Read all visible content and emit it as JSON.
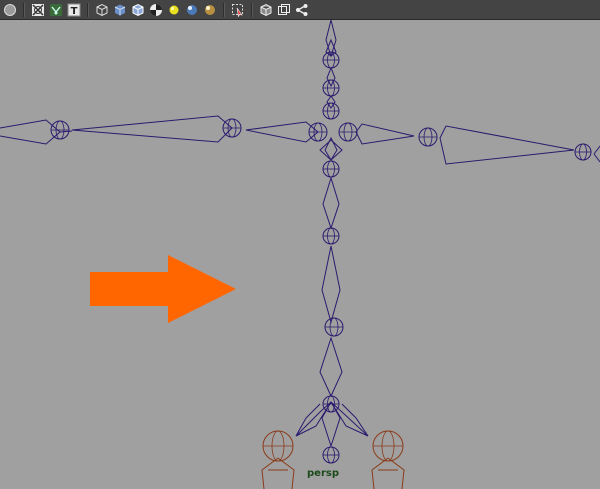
{
  "toolbar": {
    "items": [
      {
        "icon": "smooth-shade-icon"
      },
      {
        "icon": "wireframe-icon"
      },
      {
        "icon": "xray-icon"
      },
      {
        "icon": "texture-icon",
        "glyph": "T"
      },
      {
        "icon": "wire-cube-icon"
      },
      {
        "icon": "shaded-cube-icon"
      },
      {
        "icon": "shaded-wire-cube-icon"
      },
      {
        "icon": "checker-icon"
      },
      {
        "icon": "default-light-icon"
      },
      {
        "icon": "all-lights-icon"
      },
      {
        "icon": "selected-light-icon"
      },
      {
        "icon": "isolate-select-icon"
      },
      {
        "icon": "bounding-box-icon"
      },
      {
        "icon": "frame-icon"
      },
      {
        "icon": "share-icon"
      }
    ]
  },
  "viewport": {
    "camera_label": "persp",
    "background_color": "#a0a0a0",
    "joint_color": "#2b1a6e",
    "leg_joint_color": "#8a3a1a",
    "arrow_color": "#ff6600"
  }
}
